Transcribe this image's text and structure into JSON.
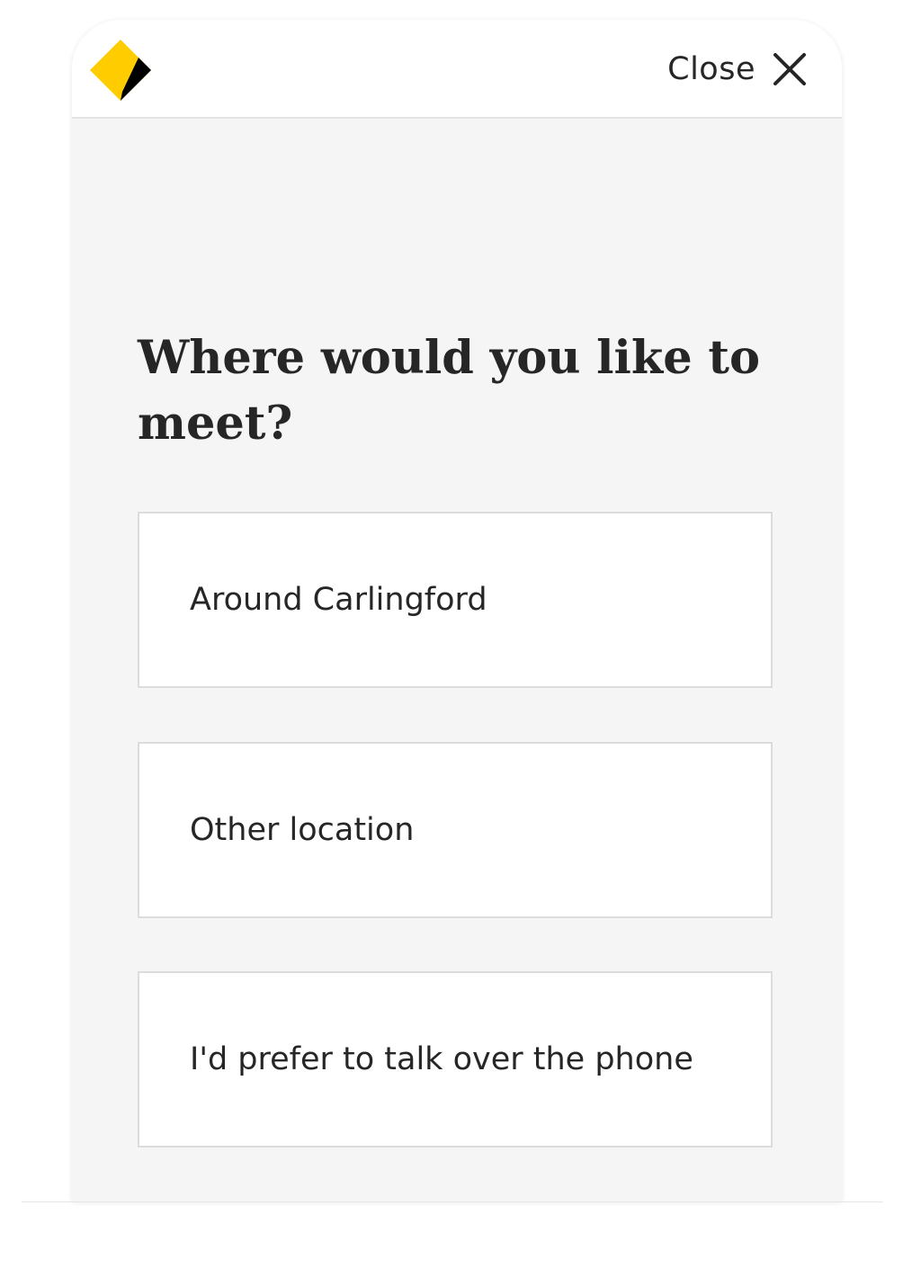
{
  "header": {
    "logo_icon": "commbank-diamond-logo",
    "close_label": "Close",
    "close_icon": "close-x-icon"
  },
  "question": {
    "title": "Where would you like to meet?"
  },
  "options": [
    {
      "label": "Around Carlingford"
    },
    {
      "label": "Other location"
    },
    {
      "label": "I'd prefer to talk over the phone"
    }
  ],
  "colors": {
    "brand_yellow": "#FFCC00",
    "brand_black": "#000000",
    "background": "#F5F5F5",
    "card": "#FFFFFF",
    "text": "#262626"
  }
}
